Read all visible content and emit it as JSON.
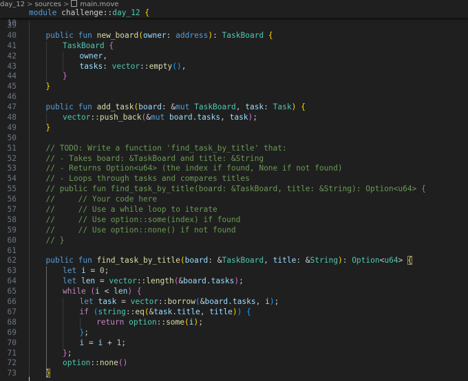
{
  "breadcrumb": {
    "segments": [
      "day_12",
      "sources",
      "main.move"
    ],
    "separator": ">"
  },
  "sticky": {
    "number": "10",
    "text": "module challenge::day_12 {"
  },
  "lines": [
    {
      "n": "39",
      "indent": 1,
      "t": []
    },
    {
      "n": "40",
      "indent": 1,
      "t": [
        [
          "kw",
          "public "
        ],
        [
          "kw",
          "fun "
        ],
        [
          "fn",
          "new_board"
        ],
        [
          "b1",
          "("
        ],
        [
          "var",
          "owner"
        ],
        [
          "pn",
          ": "
        ],
        [
          "kw",
          "address"
        ],
        [
          "b1",
          ")"
        ],
        [
          "pn",
          ": "
        ],
        [
          "ty",
          "TaskBoard"
        ],
        [
          "pn",
          " "
        ],
        [
          "b1",
          "{"
        ]
      ]
    },
    {
      "n": "41",
      "indent": 2,
      "t": [
        [
          "ty",
          "TaskBoard"
        ],
        [
          "pn",
          " "
        ],
        [
          "b2",
          "{"
        ]
      ]
    },
    {
      "n": "42",
      "indent": 3,
      "t": [
        [
          "var",
          "owner"
        ],
        [
          "pn",
          ","
        ]
      ]
    },
    {
      "n": "43",
      "indent": 3,
      "t": [
        [
          "var",
          "tasks"
        ],
        [
          "pn",
          ": "
        ],
        [
          "ty",
          "vector"
        ],
        [
          "pn",
          "::"
        ],
        [
          "fn",
          "empty"
        ],
        [
          "b3",
          "()"
        ],
        [
          "pn",
          ","
        ]
      ]
    },
    {
      "n": "44",
      "indent": 2,
      "t": [
        [
          "b2",
          "}"
        ]
      ]
    },
    {
      "n": "45",
      "indent": 1,
      "t": [
        [
          "b1",
          "}"
        ]
      ]
    },
    {
      "n": "46",
      "indent": 1,
      "t": []
    },
    {
      "n": "47",
      "indent": 1,
      "t": [
        [
          "kw",
          "public "
        ],
        [
          "kw",
          "fun "
        ],
        [
          "fn",
          "add_task"
        ],
        [
          "b1",
          "("
        ],
        [
          "var",
          "board"
        ],
        [
          "pn",
          ": &"
        ],
        [
          "kw",
          "mut "
        ],
        [
          "ty",
          "TaskBoard"
        ],
        [
          "pn",
          ", "
        ],
        [
          "var",
          "task"
        ],
        [
          "pn",
          ": "
        ],
        [
          "ty",
          "Task"
        ],
        [
          "b1",
          ")"
        ],
        [
          "pn",
          " "
        ],
        [
          "b1",
          "{"
        ]
      ]
    },
    {
      "n": "48",
      "indent": 2,
      "t": [
        [
          "ty",
          "vector"
        ],
        [
          "pn",
          "::"
        ],
        [
          "fn",
          "push_back"
        ],
        [
          "b2",
          "("
        ],
        [
          "pn",
          "&"
        ],
        [
          "kw",
          "mut "
        ],
        [
          "var",
          "board"
        ],
        [
          "pn",
          "."
        ],
        [
          "var",
          "tasks"
        ],
        [
          "pn",
          ", "
        ],
        [
          "var",
          "task"
        ],
        [
          "b2",
          ")"
        ],
        [
          "pn",
          ";"
        ]
      ]
    },
    {
      "n": "49",
      "indent": 1,
      "t": [
        [
          "b1",
          "}"
        ]
      ]
    },
    {
      "n": "50",
      "indent": 1,
      "t": []
    },
    {
      "n": "51",
      "indent": 1,
      "t": [
        [
          "cm",
          "// TODO: Write a function 'find_task_by_title' that:"
        ]
      ]
    },
    {
      "n": "52",
      "indent": 1,
      "t": [
        [
          "cm",
          "// - Takes board: &TaskBoard and title: &String"
        ]
      ]
    },
    {
      "n": "53",
      "indent": 1,
      "t": [
        [
          "cm",
          "// - Returns Option<u64> (the index if found, None if not found)"
        ]
      ]
    },
    {
      "n": "54",
      "indent": 1,
      "t": [
        [
          "cm",
          "// - Loops through tasks and compares titles"
        ]
      ]
    },
    {
      "n": "55",
      "indent": 1,
      "t": [
        [
          "cm",
          "// public fun find_task_by_title(board: &TaskBoard, title: &String): Option<u64> {"
        ]
      ]
    },
    {
      "n": "56",
      "indent": 1,
      "t": [
        [
          "cm",
          "//     // Your code here"
        ]
      ]
    },
    {
      "n": "57",
      "indent": 1,
      "t": [
        [
          "cm",
          "//     // Use a while loop to iterate"
        ]
      ]
    },
    {
      "n": "58",
      "indent": 1,
      "t": [
        [
          "cm",
          "//     // Use option::some(index) if found"
        ]
      ]
    },
    {
      "n": "59",
      "indent": 1,
      "t": [
        [
          "cm",
          "//     // Use option::none() if not found"
        ]
      ]
    },
    {
      "n": "60",
      "indent": 1,
      "t": [
        [
          "cm",
          "// }"
        ]
      ]
    },
    {
      "n": "61",
      "indent": 1,
      "t": []
    },
    {
      "n": "62",
      "indent": 1,
      "t": [
        [
          "kw",
          "public "
        ],
        [
          "kw",
          "fun "
        ],
        [
          "fn",
          "find_task_by_title"
        ],
        [
          "b1",
          "("
        ],
        [
          "var",
          "board"
        ],
        [
          "pn",
          ": &"
        ],
        [
          "ty",
          "TaskBoard"
        ],
        [
          "pn",
          ", "
        ],
        [
          "var",
          "title"
        ],
        [
          "pn",
          ": &"
        ],
        [
          "ty",
          "String"
        ],
        [
          "b1",
          ")"
        ],
        [
          "pn",
          ": "
        ],
        [
          "ty",
          "Option"
        ],
        [
          "pn",
          "<"
        ],
        [
          "ty",
          "u64"
        ],
        [
          "pn",
          "> "
        ],
        [
          "b1 bm",
          "{"
        ]
      ]
    },
    {
      "n": "63",
      "indent": 2,
      "active": 2,
      "t": [
        [
          "kw",
          "let "
        ],
        [
          "var",
          "i"
        ],
        [
          "pn",
          " = "
        ],
        [
          "num",
          "0"
        ],
        [
          "pn",
          ";"
        ]
      ]
    },
    {
      "n": "64",
      "indent": 2,
      "active": 2,
      "t": [
        [
          "kw",
          "let "
        ],
        [
          "var",
          "len"
        ],
        [
          "pn",
          " = "
        ],
        [
          "ty",
          "vector"
        ],
        [
          "pn",
          "::"
        ],
        [
          "fn",
          "length"
        ],
        [
          "b2",
          "("
        ],
        [
          "pn",
          "&"
        ],
        [
          "var",
          "board"
        ],
        [
          "pn",
          "."
        ],
        [
          "var",
          "tasks"
        ],
        [
          "b2",
          ")"
        ],
        [
          "pn",
          ";"
        ]
      ]
    },
    {
      "n": "65",
      "indent": 2,
      "active": 2,
      "t": [
        [
          "ctl",
          "while "
        ],
        [
          "b2",
          "("
        ],
        [
          "var",
          "i"
        ],
        [
          "pn",
          " < "
        ],
        [
          "var",
          "len"
        ],
        [
          "b2",
          ")"
        ],
        [
          "pn",
          " "
        ],
        [
          "b2",
          "{"
        ]
      ]
    },
    {
      "n": "66",
      "indent": 3,
      "active": 2,
      "t": [
        [
          "kw",
          "let "
        ],
        [
          "var",
          "task"
        ],
        [
          "pn",
          " = "
        ],
        [
          "ty",
          "vector"
        ],
        [
          "pn",
          "::"
        ],
        [
          "fn",
          "borrow"
        ],
        [
          "b3",
          "("
        ],
        [
          "pn",
          "&"
        ],
        [
          "var",
          "board"
        ],
        [
          "pn",
          "."
        ],
        [
          "var",
          "tasks"
        ],
        [
          "pn",
          ", "
        ],
        [
          "var",
          "i"
        ],
        [
          "b3",
          ")"
        ],
        [
          "pn",
          ";"
        ]
      ]
    },
    {
      "n": "67",
      "indent": 3,
      "active": 2,
      "t": [
        [
          "ctl",
          "if "
        ],
        [
          "b3",
          "("
        ],
        [
          "ty",
          "string"
        ],
        [
          "pn",
          "::"
        ],
        [
          "fn",
          "eq"
        ],
        [
          "b1",
          "("
        ],
        [
          "pn",
          "&"
        ],
        [
          "var",
          "task"
        ],
        [
          "pn",
          "."
        ],
        [
          "var",
          "title"
        ],
        [
          "pn",
          ", "
        ],
        [
          "var",
          "title"
        ],
        [
          "b1",
          ")"
        ],
        [
          "b3",
          ")"
        ],
        [
          "pn",
          " "
        ],
        [
          "b3",
          "{"
        ]
      ]
    },
    {
      "n": "68",
      "indent": 4,
      "active": 2,
      "t": [
        [
          "ctl",
          "return "
        ],
        [
          "ty",
          "option"
        ],
        [
          "pn",
          "::"
        ],
        [
          "fn",
          "some"
        ],
        [
          "b1",
          "("
        ],
        [
          "var",
          "i"
        ],
        [
          "b1",
          ")"
        ],
        [
          "pn",
          ";"
        ]
      ]
    },
    {
      "n": "69",
      "indent": 3,
      "active": 2,
      "t": [
        [
          "b3",
          "}"
        ],
        [
          "pn",
          ";"
        ]
      ]
    },
    {
      "n": "70",
      "indent": 3,
      "active": 2,
      "t": [
        [
          "var",
          "i"
        ],
        [
          "pn",
          " = "
        ],
        [
          "var",
          "i"
        ],
        [
          "pn",
          " + "
        ],
        [
          "num",
          "1"
        ],
        [
          "pn",
          ";"
        ]
      ]
    },
    {
      "n": "71",
      "indent": 2,
      "active": 2,
      "t": [
        [
          "b2",
          "}"
        ],
        [
          "pn",
          ";"
        ]
      ]
    },
    {
      "n": "72",
      "indent": 2,
      "active": 2,
      "t": [
        [
          "ty",
          "option"
        ],
        [
          "pn",
          "::"
        ],
        [
          "fn",
          "none"
        ],
        [
          "b2",
          "()"
        ]
      ]
    },
    {
      "n": "73",
      "indent": 1,
      "t": [
        [
          "b1 bm",
          "}"
        ]
      ]
    }
  ]
}
